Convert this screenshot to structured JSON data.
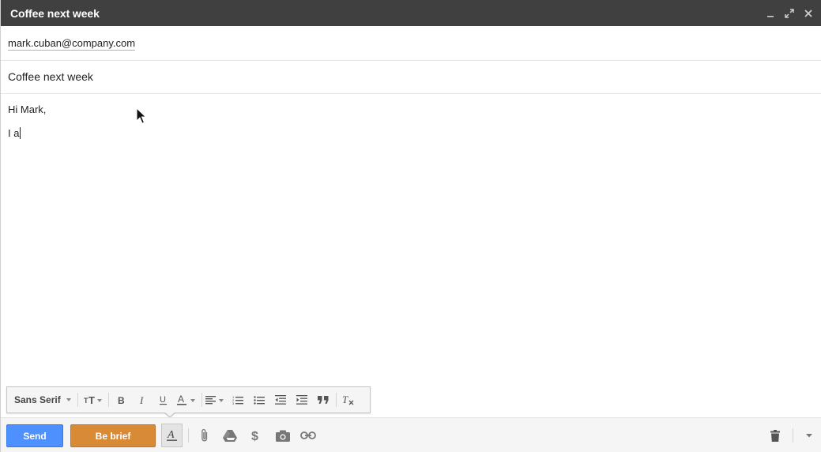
{
  "window": {
    "title": "Coffee next week",
    "controls": [
      "minimize-icon",
      "pop-out-icon",
      "close-icon"
    ]
  },
  "to": {
    "recipient": "mark.cuban@company.com"
  },
  "subject": {
    "value": "Coffee next week"
  },
  "body": {
    "lines": [
      "Hi Mark,",
      "I a"
    ]
  },
  "format_bar": {
    "font": "Sans Serif",
    "tools": [
      "text-size-icon",
      "bold-icon",
      "italic-icon",
      "underline-icon",
      "text-color-icon",
      "align-icon",
      "numbered-list-icon",
      "bulleted-list-icon",
      "indent-less-icon",
      "indent-more-icon",
      "quote-icon",
      "remove-formatting-icon"
    ]
  },
  "bottom_bar": {
    "send_label": "Send",
    "brief_label": "Be brief",
    "icons": [
      "formatting-toggle-icon",
      "attach-icon",
      "drive-icon",
      "money-icon",
      "photo-icon",
      "link-icon",
      "trash-icon",
      "more-options-icon"
    ]
  },
  "colors": {
    "titlebar": "#404040",
    "send": "#4d90fe",
    "brief": "#d98a37",
    "recipient_underline": "#f4b400"
  }
}
